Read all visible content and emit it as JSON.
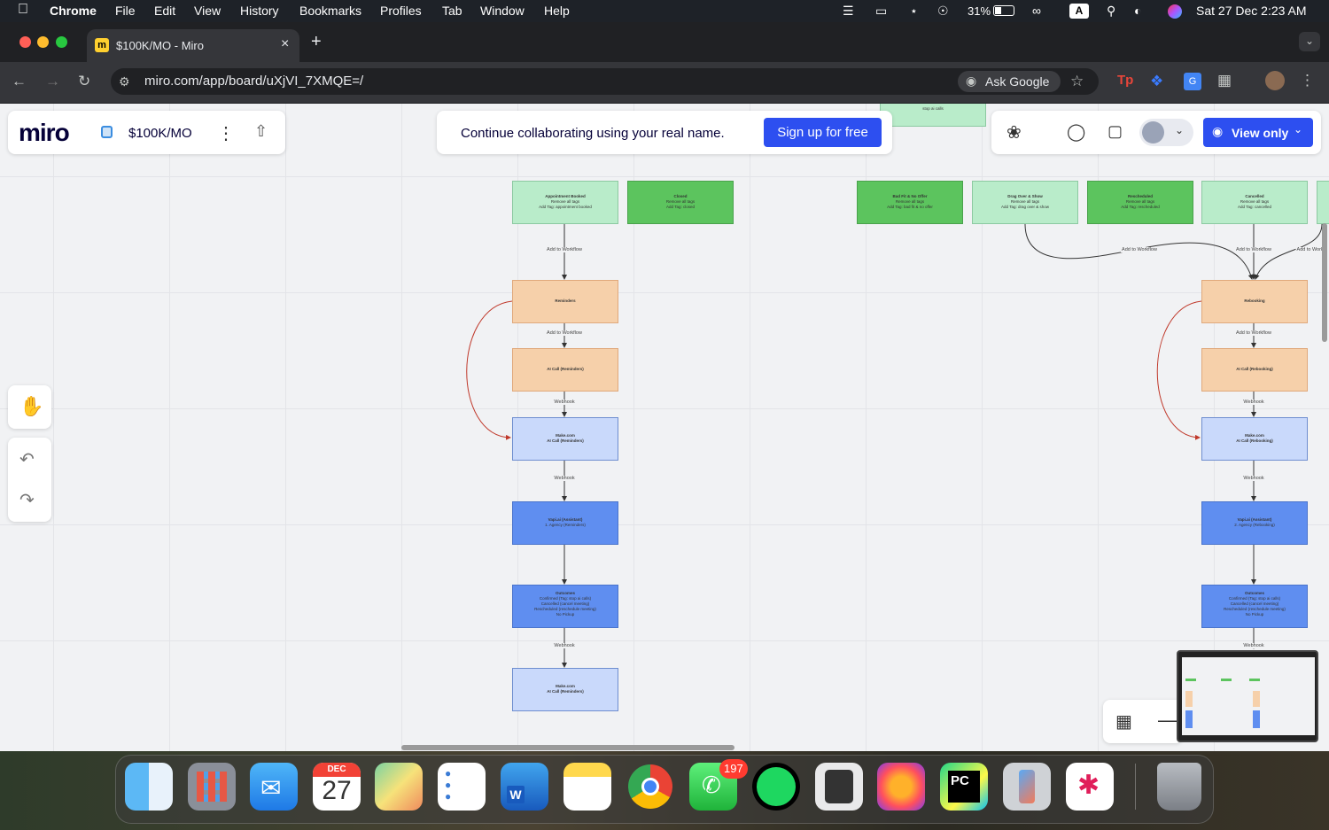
{
  "menubar": {
    "app": "Chrome",
    "menus": [
      "File",
      "Edit",
      "View",
      "History",
      "Bookmarks",
      "Profiles",
      "Tab",
      "Window",
      "Help"
    ],
    "battery": "31%",
    "datetime": "Sat 27 Dec  2:23 AM",
    "input": "A"
  },
  "tab": {
    "title": "$100K/MO - Miro"
  },
  "address": {
    "url": "miro.com/app/board/uXjVI_7XMQE=/",
    "ask_google": "Ask Google"
  },
  "miro": {
    "logo": "miro",
    "board_name": "$100K/MO",
    "banner_text": "Continue collaborating using your real name.",
    "signup": "Sign up for free",
    "view_only": "View only"
  },
  "nodes": [
    {
      "title": "Appointment Booked",
      "lines": [
        "Remove all tags",
        "Add Tag: appointment booked"
      ]
    },
    {
      "title": "Closed",
      "lines": [
        "Remove all tags",
        "Add Tag: closed"
      ]
    },
    {
      "title": "Bad Fit & No Offer",
      "lines": [
        "Remove all tags",
        "Add Tag: bad fit & no offer"
      ]
    },
    {
      "title": "Drag Over & Show",
      "lines": [
        "Remove all tags",
        "Add Tag: drag over & show"
      ]
    },
    {
      "title": "Rescheduled",
      "lines": [
        "Remove all tags",
        "Add Tag: rescheduled"
      ]
    },
    {
      "title": "Cancelled",
      "lines": [
        "Remove all tags",
        "Add Tag: cancelled"
      ]
    },
    {
      "title": "Reminders",
      "lines": []
    },
    {
      "title": "AI Call (Reminders)",
      "lines": []
    },
    {
      "title": "Make.com",
      "lines": [
        "AI Call (Reminders)"
      ]
    },
    {
      "title": "Vapi.ai (Assistant)",
      "lines": [
        "1. Agency (Reminders)"
      ]
    },
    {
      "title": "Outcomes",
      "lines": [
        "Confirmed (Tag: stop ai calls)",
        "Cancelled (cancel meeting)",
        "Rescheduled (reschedule meeting)",
        "No Pickup"
      ]
    },
    {
      "title": "Make.com",
      "lines": [
        "AI Call (Reminders)"
      ]
    },
    {
      "title": "Rebooking",
      "lines": []
    },
    {
      "title": "AI Call (Rebooking)",
      "lines": []
    },
    {
      "title": "Make.com",
      "lines": [
        "AI Call (Rebooking)"
      ]
    },
    {
      "title": "Vapi.ai (Assistant)",
      "lines": [
        "2. Agency (Rebooking)"
      ]
    },
    {
      "title": "Outcomes",
      "lines": [
        "Confirmed (Tag: stop ai calls)",
        "Cancelled (cancel meeting)",
        "Rescheduled (reschedule meeting)",
        "No Pickup"
      ]
    },
    {
      "title": "",
      "lines": [
        "stop ai calls"
      ]
    }
  ],
  "edge_labels": {
    "add": "Add to Workflow",
    "add_cut": "Add to Workfl",
    "webhook": "Webhook"
  },
  "dock": {
    "calendar_month": "DEC",
    "calendar_day": "27",
    "whatsapp_badge": "197"
  },
  "colors": {
    "accent": "#2d4ff0",
    "green_light": "#b9ecca",
    "green": "#5cc45e",
    "orange": "#f6d0aa",
    "blue_light": "#c9d9fb",
    "blue": "#5f8ef0"
  }
}
